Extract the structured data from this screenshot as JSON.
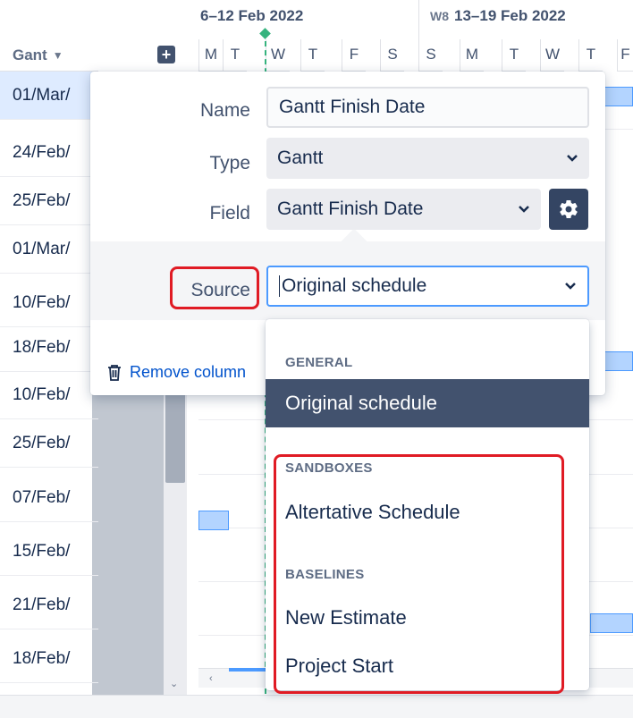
{
  "timeline": {
    "week1": {
      "label": "6–12 Feb 2022"
    },
    "week2": {
      "number": "W8",
      "label": "13–19 Feb 2022"
    },
    "days": [
      "M",
      "T",
      "W",
      "T",
      "F",
      "S",
      "S",
      "M",
      "T",
      "W",
      "T",
      "F"
    ]
  },
  "column": {
    "header_label": "Gant",
    "dates": [
      "01/Mar/",
      "24/Feb/",
      "25/Feb/",
      "01/Mar/",
      "10/Feb/",
      "18/Feb/",
      "10/Feb/",
      "25/Feb/",
      "07/Feb/",
      "15/Feb/",
      "21/Feb/",
      "18/Feb/"
    ]
  },
  "popup": {
    "name_label": "Name",
    "name_value": "Gantt Finish Date",
    "type_label": "Type",
    "type_value": "Gantt",
    "field_label": "Field",
    "field_value": "Gantt Finish Date",
    "source_label": "Source",
    "source_value": "Original schedule",
    "remove_label": "Remove column"
  },
  "menu": {
    "general_header": "GENERAL",
    "general_item": "Original schedule",
    "sandboxes_header": "SANDBOXES",
    "sandboxes_item": "Altertative Schedule",
    "baselines_header": "BASELINES",
    "baselines_items": [
      "New Estimate",
      "Project Start"
    ]
  },
  "colors": {
    "accent": "#4c9aff",
    "highlight": "#e01b24",
    "selected_item": "#42526e"
  }
}
